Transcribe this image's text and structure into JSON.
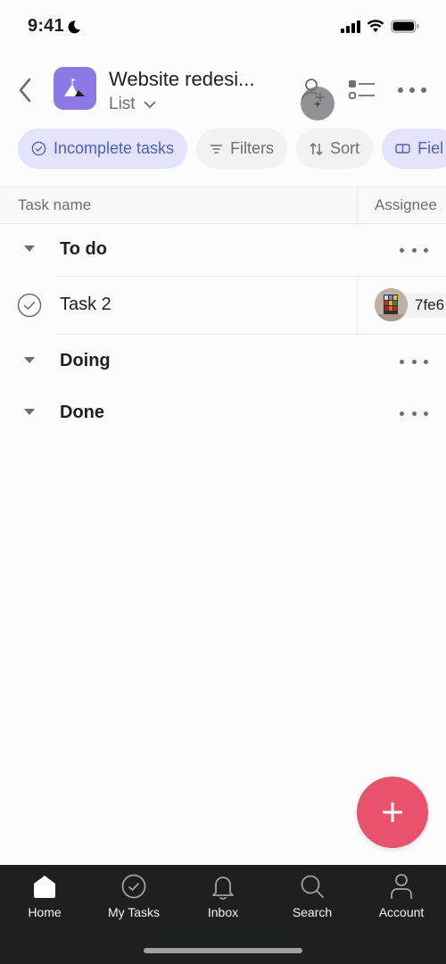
{
  "status_bar": {
    "time": "9:41",
    "focus_icon": "moon-icon",
    "signal_icon": "cellular-signal-icon",
    "wifi_icon": "wifi-icon",
    "battery_icon": "battery-icon"
  },
  "header": {
    "back_icon": "chevron-left-icon",
    "project_icon": "mountain-flag-icon",
    "project_icon_color": "#8d79e6",
    "title": "Website redesi...",
    "view_label": "List",
    "view_chevron": "chevron-down-icon",
    "actions": [
      "add-member-icon",
      "layout-toggle-icon",
      "more-icon"
    ]
  },
  "chips": [
    {
      "label": "Incomplete tasks",
      "icon": "check-circle-icon",
      "active": true
    },
    {
      "label": "Filters",
      "icon": "filter-icon",
      "active": false
    },
    {
      "label": "Sort",
      "icon": "sort-icon",
      "active": false
    },
    {
      "label": "Fiel",
      "icon": "fields-icon",
      "active": true
    }
  ],
  "table": {
    "columns": [
      "Task name",
      "Assignee"
    ],
    "sections": [
      {
        "name": "To do",
        "tasks": [
          {
            "name": "Task 2",
            "completed": false,
            "assignee": "7fe6"
          }
        ]
      },
      {
        "name": "Doing",
        "tasks": []
      },
      {
        "name": "Done",
        "tasks": []
      }
    ]
  },
  "fab": {
    "icon": "plus-icon",
    "color": "#e8526d"
  },
  "bottom_nav": [
    {
      "label": "Home",
      "icon": "home-icon",
      "active": true
    },
    {
      "label": "My Tasks",
      "icon": "check-circle-icon",
      "active": false
    },
    {
      "label": "Inbox",
      "icon": "bell-icon",
      "active": false
    },
    {
      "label": "Search",
      "icon": "search-icon",
      "active": false
    },
    {
      "label": "Account",
      "icon": "account-icon",
      "active": false
    }
  ]
}
